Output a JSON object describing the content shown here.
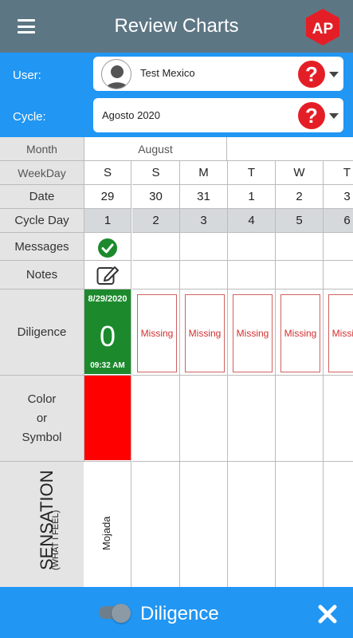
{
  "header": {
    "title": "Review Charts",
    "menu_icon": "hamburger-menu-icon",
    "logo_text": "AP"
  },
  "selector": {
    "user_label": "User:",
    "user_value": "Test Mexico",
    "cycle_label": "Cycle:",
    "cycle_value": "Agosto 2020",
    "help_icon": "question-mark-icon"
  },
  "table": {
    "row_labels": {
      "month": "Month",
      "weekday": "WeekDay",
      "date": "Date",
      "cycle_day": "Cycle Day",
      "messages": "Messages",
      "notes": "Notes",
      "diligence": "Diligence",
      "color_line1": "Color",
      "color_line2": "or",
      "color_line3": "Symbol",
      "sensation": "SENSATION",
      "sensation_sub": "(WHAT I FEEL)"
    },
    "month": "August",
    "weekdays": [
      "S",
      "S",
      "M",
      "T",
      "W",
      "T"
    ],
    "dates": [
      "29",
      "30",
      "31",
      "1",
      "2",
      "3"
    ],
    "cycle_days": [
      "1",
      "2",
      "3",
      "4",
      "5",
      "6"
    ],
    "diligence_entry": {
      "date": "8/29/2020",
      "value": "0",
      "time": "09:32 AM"
    },
    "missing_label": "Missing",
    "sensation_value": "Mojada",
    "colors": {
      "green": "#1c8a2c",
      "red": "#ff0000",
      "missing": "#d32f2f"
    }
  },
  "footer": {
    "toggle_label": "Diligence",
    "close_icon": "close-icon"
  }
}
